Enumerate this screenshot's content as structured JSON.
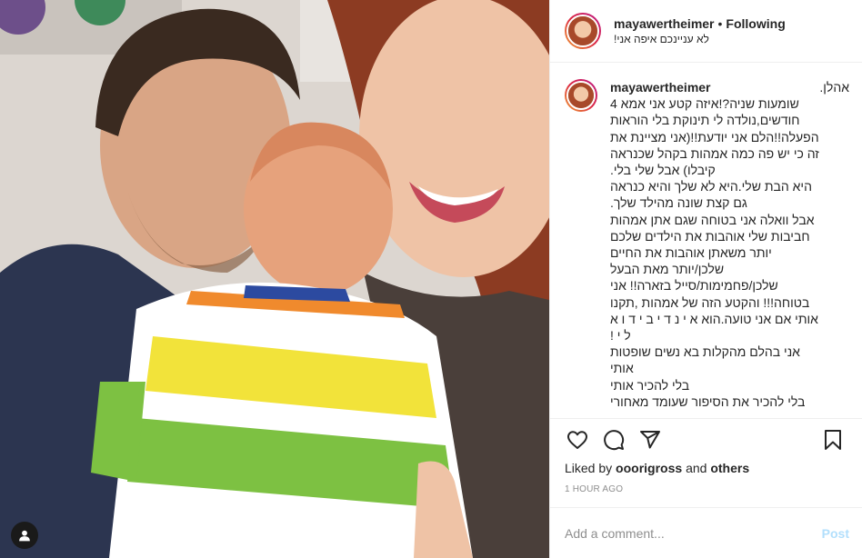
{
  "post": {
    "author": {
      "username": "mayawertheimer",
      "follow_state": "Following",
      "separator": "•",
      "location": "לא עניינכם איפה אני!"
    },
    "caption": {
      "username": "mayawertheimer",
      "lines": [
        "אהלן.",
        "שומעות שניה?!איזה קטע אני אמא 4",
        "חודשים,נולדה לי תינוקת בלי הוראות",
        "הפעלה!!הלם אני יודעת!!(אני מציינת את",
        "זה כי יש פה כמה אמהות בקהל שכנראה",
        "קיבלו) אבל שלי בלי.",
        "היא הבת שלי.היא לא שלך והיא כנראה",
        "גם קצת שונה מהילד שלך.",
        "אבל וואלה אני בטוחה שגם אתן אמהות",
        "חביבות שלי אוהבות את הילדים שלכם",
        "יותר משאתן אוהבות את החיים",
        "שלכן/יותר מאת הבעל",
        "שלכן/פחמימות/סייל בזארה!! אני",
        "בטוחה!!! והקטע הזה של אמהות ,תקנו",
        "אותי אם אני טועה.הוא א י נ ד י ב י ד ו א",
        "ל י !",
        "אני בהלם מהקלות בא נשים שופטות",
        "אותי",
        "בלי להכיר אותי",
        "בלי להכיר את הסיפור שעומד מאחורי"
      ]
    },
    "actions": {
      "like_icon": "heart-icon",
      "comment_icon": "comment-icon",
      "share_icon": "paper-plane-icon",
      "save_icon": "bookmark-icon"
    },
    "likes": {
      "prefix": "Liked by",
      "liker": "ooorigross",
      "connector": "and",
      "others": "others"
    },
    "timestamp": "1 HOUR AGO",
    "comment_box": {
      "placeholder": "Add a comment...",
      "post_label": "Post"
    },
    "colors": {
      "post_button_disabled": "#b2dffc",
      "border": "#efefef",
      "muted_text": "#8e8e8e"
    }
  }
}
